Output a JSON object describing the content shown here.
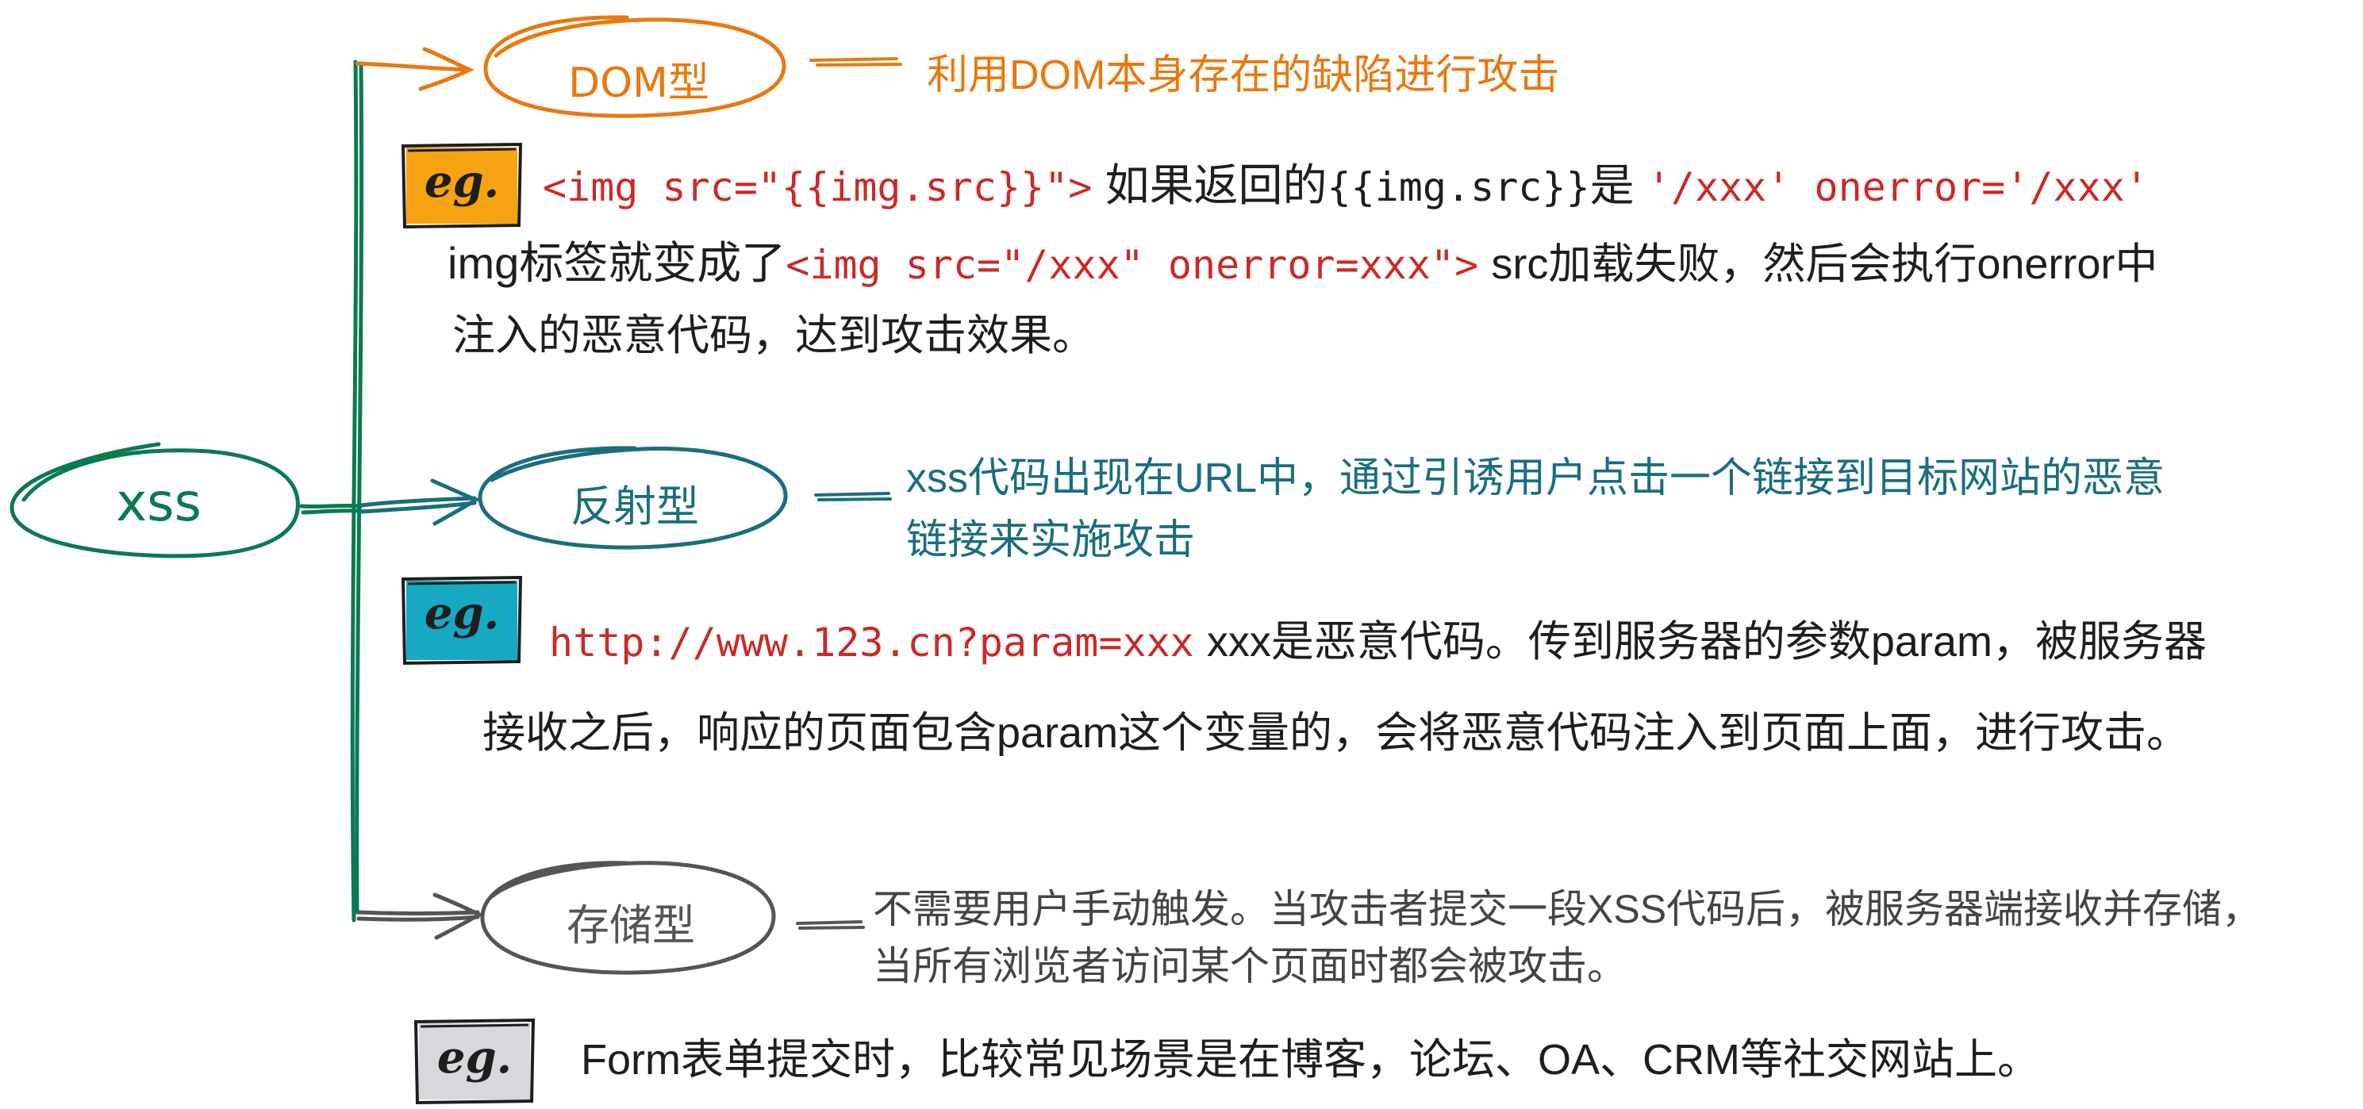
{
  "colors": {
    "green": "#0b7a4f",
    "orange": "#e8790f",
    "teal": "#1a6e7d",
    "gray": "#555555",
    "eg_orange_fill": "#f5a311",
    "eg_teal_fill": "#17a8c2",
    "eg_gray_fill": "#d8d8dc",
    "code_red": "#c92a2a",
    "text": "#1e1e1e"
  },
  "root": {
    "label": "xss"
  },
  "branches": {
    "dom": {
      "label": "DOM型",
      "desc": "利用DOM本身存在的缺陷进行攻击",
      "eg_badge": "eg.",
      "example": {
        "line1_code1": "<img src=\"{{img.src}}\">",
        "line1_text1": "如果返回的",
        "line1_code2": "{{img.src}}",
        "line1_text2": "是",
        "line1_code3": "'/xxx' onerror='/xxx'",
        "line2_text1": "img标签就变成了",
        "line2_code": "<img src=\"/xxx\" onerror=xxx\">",
        "line2_text2": "src加载失败，然后会执行onerror中",
        "line3_text": "注入的恶意代码，达到攻击效果。"
      }
    },
    "reflected": {
      "label": "反射型",
      "desc_line1": "xss代码出现在URL中，通过引诱用户点击一个链接到目标网站的恶意",
      "desc_line2": "链接来实施攻击",
      "eg_badge": "eg.",
      "example": {
        "line1_code": "http://www.123.cn?param=xxx",
        "line1_text": "xxx是恶意代码。传到服务器的参数param，被服务器",
        "line2_text": "接收之后，响应的页面包含param这个变量的，会将恶意代码注入到页面上面，进行攻击。"
      }
    },
    "stored": {
      "label": "存储型",
      "desc_line1": "不需要用户手动触发。当攻击者提交一段XSS代码后，被服务器端接收并存储，",
      "desc_line2": "当所有浏览者访问某个页面时都会被攻击。",
      "eg_badge": "eg.",
      "example": {
        "line1_text": "Form表单提交时，比较常见场景是在博客，论坛、OA、CRM等社交网站上。"
      }
    }
  }
}
